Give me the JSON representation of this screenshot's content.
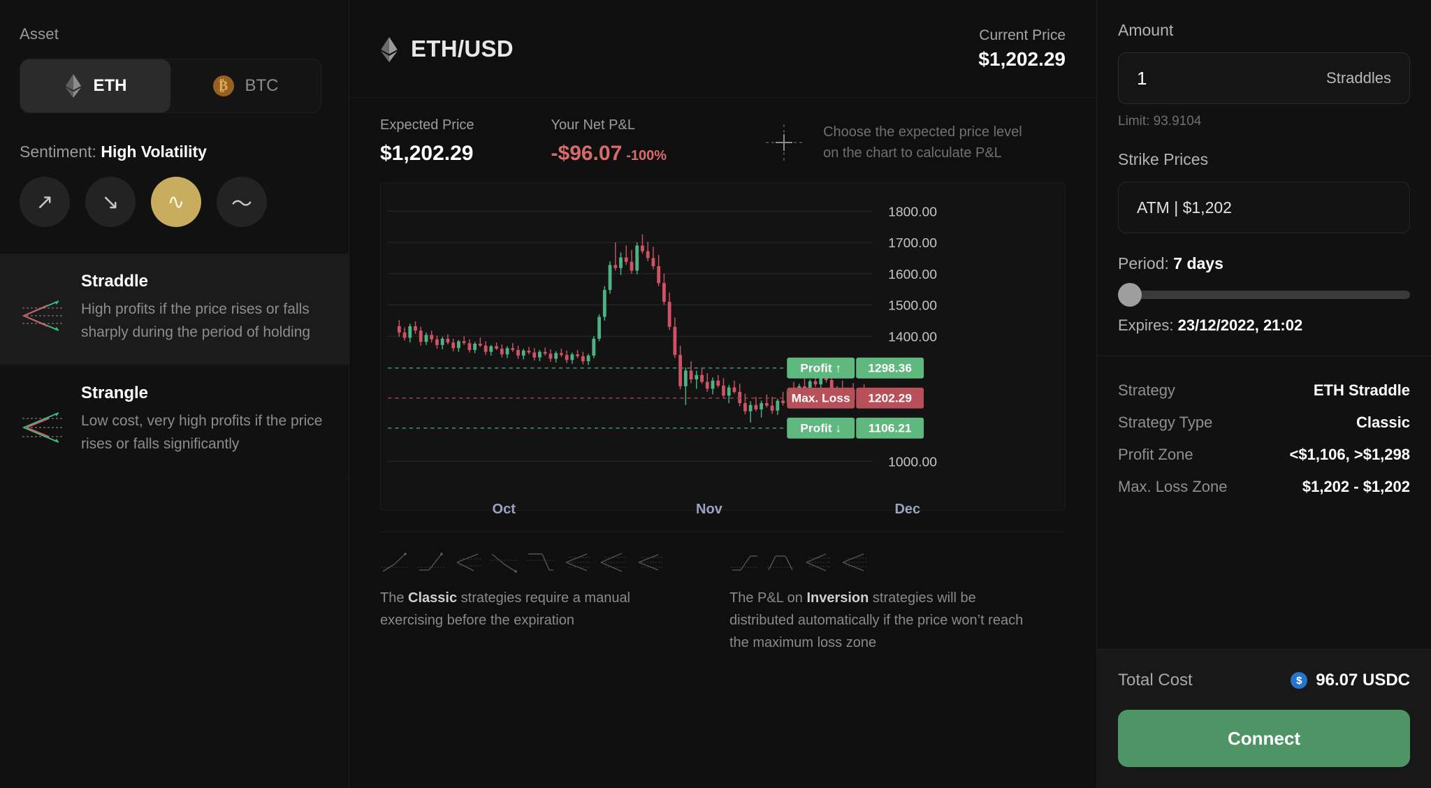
{
  "sidebar": {
    "asset_label": "Asset",
    "assets": [
      {
        "symbol": "ETH",
        "icon": "ethereum-icon",
        "active": true
      },
      {
        "symbol": "BTC",
        "icon": "bitcoin-icon",
        "active": false
      }
    ],
    "sentiment_prefix": "Sentiment:",
    "sentiment_value": "High Volatility",
    "sentiment_buttons": [
      {
        "name": "up-arrow-icon",
        "glyph": "↗",
        "active": false
      },
      {
        "name": "down-arrow-icon",
        "glyph": "↘",
        "active": false
      },
      {
        "name": "high-volatility-icon",
        "glyph": "∿",
        "active": true
      },
      {
        "name": "low-volatility-icon",
        "glyph": "〜",
        "active": false
      }
    ],
    "strategies": [
      {
        "title": "Straddle",
        "desc": "High profits if the price rises or falls sharply during the period of holding",
        "selected": true
      },
      {
        "title": "Strangle",
        "desc": "Low cost, very high profits if the price rises or falls significantly",
        "selected": false
      }
    ]
  },
  "center": {
    "pair": "ETH/USD",
    "pair_icon": "ethereum-icon",
    "current_price_label": "Current Price",
    "current_price_value": "$1,202.29",
    "expected_price_label": "Expected Price",
    "expected_price_value": "$1,202.29",
    "net_pnl_label": "Your Net P&L",
    "net_pnl_value": "-$96.07",
    "net_pnl_pct": "-100%",
    "hint_line1": "Choose the expected price level",
    "hint_line2": "on the chart to calculate P&L",
    "legend_left_text_pre": "The ",
    "legend_left_text_bold": "Classic",
    "legend_left_text_post": " strategies require a manual exercising before the expiration",
    "legend_right_text_pre": "The P&L on ",
    "legend_right_text_bold": "Inversion",
    "legend_right_text_post": " strategies will be distributed automatically if the price won’t reach the maximum loss zone"
  },
  "chart_data": {
    "type": "line",
    "title": "ETH/USD",
    "xlabel": "",
    "ylabel": "",
    "ylim": [
      1000,
      1850
    ],
    "y_ticks": [
      "1800.00",
      "1700.00",
      "1600.00",
      "1500.00",
      "1400.00",
      "1000.00"
    ],
    "y_tick_values": [
      1800,
      1700,
      1600,
      1500,
      1400,
      1000
    ],
    "x_ticks": [
      "Oct",
      "Nov",
      "Dec"
    ],
    "grid": true,
    "markers": [
      {
        "label": "Profit ↑",
        "value": "1298.36",
        "numeric": 1298.36,
        "color": "#5fb97f",
        "style": "dashed-green"
      },
      {
        "label": "Max. Loss",
        "value": "1202.29",
        "numeric": 1202.29,
        "color": "#b8505a",
        "style": "dashed-red"
      },
      {
        "label": "Profit ↓",
        "value": "1106.21",
        "numeric": 1106.21,
        "color": "#5fb97f",
        "style": "dashed-green"
      }
    ],
    "series_note": "OHLC candlesticks, green up / red down",
    "candles": [
      [
        1432,
        1452,
        1398,
        1412
      ],
      [
        1412,
        1428,
        1386,
        1395
      ],
      [
        1395,
        1440,
        1380,
        1432
      ],
      [
        1432,
        1448,
        1408,
        1418
      ],
      [
        1418,
        1430,
        1370,
        1382
      ],
      [
        1382,
        1412,
        1372,
        1404
      ],
      [
        1404,
        1418,
        1380,
        1390
      ],
      [
        1390,
        1402,
        1360,
        1372
      ],
      [
        1372,
        1398,
        1358,
        1392
      ],
      [
        1392,
        1406,
        1374,
        1380
      ],
      [
        1380,
        1392,
        1352,
        1362
      ],
      [
        1362,
        1388,
        1350,
        1384
      ],
      [
        1384,
        1400,
        1372,
        1378
      ],
      [
        1378,
        1390,
        1348,
        1356
      ],
      [
        1356,
        1382,
        1346,
        1376
      ],
      [
        1376,
        1396,
        1366,
        1370
      ],
      [
        1370,
        1384,
        1340,
        1350
      ],
      [
        1350,
        1372,
        1338,
        1368
      ],
      [
        1368,
        1380,
        1356,
        1360
      ],
      [
        1360,
        1374,
        1332,
        1342
      ],
      [
        1342,
        1368,
        1330,
        1362
      ],
      [
        1362,
        1378,
        1350,
        1356
      ],
      [
        1356,
        1370,
        1328,
        1338
      ],
      [
        1338,
        1360,
        1326,
        1354
      ],
      [
        1354,
        1366,
        1342,
        1348
      ],
      [
        1348,
        1362,
        1322,
        1332
      ],
      [
        1332,
        1356,
        1320,
        1350
      ],
      [
        1350,
        1364,
        1338,
        1344
      ],
      [
        1344,
        1358,
        1318,
        1328
      ],
      [
        1328,
        1352,
        1316,
        1346
      ],
      [
        1346,
        1360,
        1334,
        1340
      ],
      [
        1340,
        1354,
        1314,
        1324
      ],
      [
        1324,
        1348,
        1312,
        1342
      ],
      [
        1342,
        1356,
        1330,
        1336
      ],
      [
        1336,
        1350,
        1310,
        1320
      ],
      [
        1320,
        1344,
        1308,
        1338
      ],
      [
        1338,
        1400,
        1330,
        1392
      ],
      [
        1392,
        1470,
        1384,
        1462
      ],
      [
        1462,
        1560,
        1450,
        1548
      ],
      [
        1548,
        1640,
        1536,
        1628
      ],
      [
        1628,
        1700,
        1610,
        1618
      ],
      [
        1618,
        1668,
        1596,
        1652
      ],
      [
        1652,
        1690,
        1628,
        1638
      ],
      [
        1638,
        1676,
        1600,
        1610
      ],
      [
        1610,
        1700,
        1598,
        1690
      ],
      [
        1690,
        1726,
        1664,
        1672
      ],
      [
        1672,
        1702,
        1640,
        1650
      ],
      [
        1650,
        1686,
        1614,
        1624
      ],
      [
        1624,
        1660,
        1560,
        1570
      ],
      [
        1570,
        1600,
        1500,
        1510
      ],
      [
        1510,
        1540,
        1420,
        1430
      ],
      [
        1430,
        1460,
        1330,
        1340
      ],
      [
        1340,
        1370,
        1230,
        1240
      ],
      [
        1240,
        1300,
        1180,
        1290
      ],
      [
        1290,
        1320,
        1250,
        1262
      ],
      [
        1262,
        1290,
        1232,
        1276
      ],
      [
        1276,
        1300,
        1248,
        1254
      ],
      [
        1254,
        1282,
        1222,
        1232
      ],
      [
        1232,
        1268,
        1214,
        1258
      ],
      [
        1258,
        1276,
        1236,
        1242
      ],
      [
        1242,
        1266,
        1200,
        1210
      ],
      [
        1210,
        1244,
        1186,
        1236
      ],
      [
        1236,
        1258,
        1216,
        1222
      ],
      [
        1222,
        1248,
        1176,
        1186
      ],
      [
        1186,
        1216,
        1150,
        1160
      ],
      [
        1160,
        1192,
        1124,
        1180
      ],
      [
        1180,
        1206,
        1160,
        1166
      ],
      [
        1166,
        1194,
        1140,
        1186
      ],
      [
        1186,
        1214,
        1172,
        1178
      ],
      [
        1178,
        1206,
        1152,
        1162
      ],
      [
        1162,
        1200,
        1148,
        1194
      ],
      [
        1194,
        1222,
        1178,
        1186
      ],
      [
        1186,
        1230,
        1172,
        1224
      ],
      [
        1224,
        1254,
        1206,
        1214
      ],
      [
        1214,
        1248,
        1196,
        1240
      ],
      [
        1240,
        1268,
        1222,
        1230
      ],
      [
        1230,
        1262,
        1212,
        1256
      ],
      [
        1256,
        1284,
        1238,
        1246
      ],
      [
        1246,
        1276,
        1228,
        1270
      ],
      [
        1270,
        1296,
        1252,
        1260
      ],
      [
        1260,
        1288,
        1200,
        1208
      ],
      [
        1208,
        1240,
        1180,
        1232
      ],
      [
        1232,
        1258,
        1196,
        1204
      ],
      [
        1204,
        1236,
        1184,
        1228
      ],
      [
        1228,
        1250,
        1190,
        1198
      ],
      [
        1198,
        1230,
        1176,
        1222
      ],
      [
        1222,
        1246,
        1192,
        1202
      ]
    ]
  },
  "right": {
    "amount_label": "Amount",
    "amount_value": "1",
    "amount_unit": "Straddles",
    "limit_text": "Limit: 93.9104",
    "strike_label": "Strike Prices",
    "strike_value": "ATM  |  $1,202",
    "period_prefix": "Period:",
    "period_value": "7 days",
    "expires_prefix": "Expires:",
    "expires_value": "23/12/2022, 21:02",
    "summary": [
      {
        "key": "Strategy",
        "value": "ETH Straddle"
      },
      {
        "key": "Strategy Type",
        "value": "Classic"
      },
      {
        "key": "Profit Zone",
        "value": "<$1,106, >$1,298"
      },
      {
        "key": "Max. Loss Zone",
        "value": "$1,202 - $1,202"
      }
    ],
    "total_cost_label": "Total Cost",
    "total_cost_value": "96.07 USDC",
    "total_cost_icon": "usdc-icon",
    "connect_label": "Connect"
  },
  "colors": {
    "accent_gold": "#c8ad5f",
    "green": "#4f9464",
    "marker_green": "#5fb97f",
    "marker_red": "#b8505a",
    "loss_red": "#d96a6a",
    "usdc_blue": "#2775ca"
  }
}
